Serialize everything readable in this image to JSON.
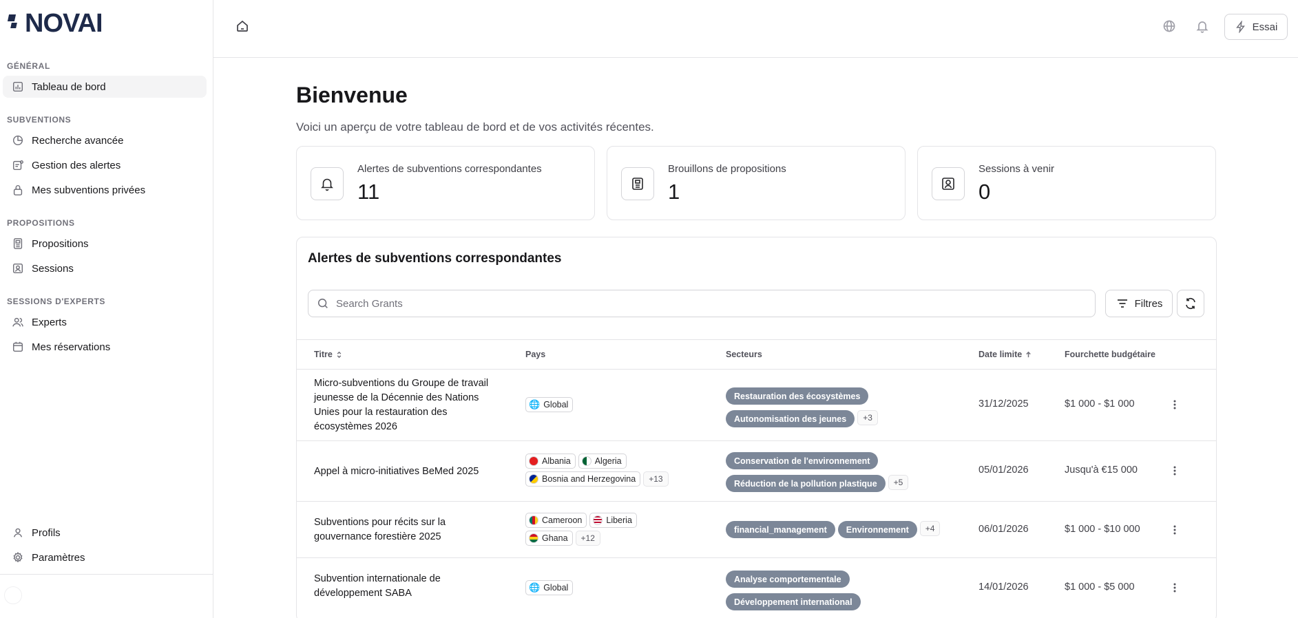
{
  "app": {
    "logo_text": "NOVAI"
  },
  "sidebar": {
    "sections": [
      {
        "label": "GÉNÉRAL"
      },
      {
        "label": "SUBVENTIONS"
      },
      {
        "label": "PROPOSITIONS"
      },
      {
        "label": "SESSIONS D'EXPERTS"
      }
    ],
    "items": [
      {
        "label": "Tableau de bord",
        "icon": "chart-icon"
      },
      {
        "label": "Recherche avancée",
        "icon": "pie-icon"
      },
      {
        "label": "Gestion des alertes",
        "icon": "alert-settings-icon"
      },
      {
        "label": "Mes subventions privées",
        "icon": "lock-icon"
      },
      {
        "label": "Propositions",
        "icon": "proposal-icon"
      },
      {
        "label": "Sessions",
        "icon": "session-icon"
      },
      {
        "label": "Experts",
        "icon": "users-icon"
      },
      {
        "label": "Mes réservations",
        "icon": "calendar-icon"
      },
      {
        "label": "Profils",
        "icon": "user-icon"
      },
      {
        "label": "Paramètres",
        "icon": "gear-icon"
      }
    ]
  },
  "topbar": {
    "essai_label": "Essai"
  },
  "main": {
    "title": "Bienvenue",
    "subtitle": "Voici un aperçu de votre tableau de bord et de vos activités récentes."
  },
  "stats": [
    {
      "label": "Alertes de subventions correspondantes",
      "value": "11"
    },
    {
      "label": "Brouillons de propositions",
      "value": "1"
    },
    {
      "label": "Sessions à venir",
      "value": "0"
    }
  ],
  "alerts": {
    "title": "Alertes de subventions correspondantes",
    "search_placeholder": "Search Grants",
    "filter_label": "Filtres",
    "columns": {
      "title": "Titre",
      "country": "Pays",
      "sectors": "Secteurs",
      "deadline": "Date limite",
      "budget": "Fourchette budgétaire"
    },
    "rows": [
      {
        "title": "Micro-subventions du Groupe de travail jeunesse de la Décennie des Nations Unies pour la restauration des écosystèmes 2026",
        "countries": [
          "Global"
        ],
        "countries_more": "",
        "sectors": [
          "Restauration des écosystèmes",
          "Autonomisation des jeunes"
        ],
        "sectors_more": "+3",
        "deadline": "31/12/2025",
        "budget": "$1 000 - $1 000"
      },
      {
        "title": "Appel à micro-initiatives BeMed 2025",
        "countries": [
          "Albania",
          "Algeria",
          "Bosnia and Herzegovina"
        ],
        "countries_more": "+13",
        "sectors": [
          "Conservation de l'environnement",
          "Réduction de la pollution plastique"
        ],
        "sectors_more": "+5",
        "deadline": "05/01/2026",
        "budget": "Jusqu'à €15 000"
      },
      {
        "title": "Subventions pour récits sur la gouvernance forestière 2025",
        "countries": [
          "Cameroon",
          "Liberia",
          "Ghana"
        ],
        "countries_more": "+12",
        "sectors": [
          "financial_management",
          "Environnement"
        ],
        "sectors_more": "+4",
        "deadline": "06/01/2026",
        "budget": "$1 000 - $10 000"
      },
      {
        "title": "Subvention internationale de développement SABA",
        "countries": [
          "Global"
        ],
        "countries_more": "",
        "sectors": [
          "Analyse comportementale",
          "Développement international"
        ],
        "sectors_more": "",
        "deadline": "14/01/2026",
        "budget": "$1 000 - $5 000"
      }
    ]
  }
}
